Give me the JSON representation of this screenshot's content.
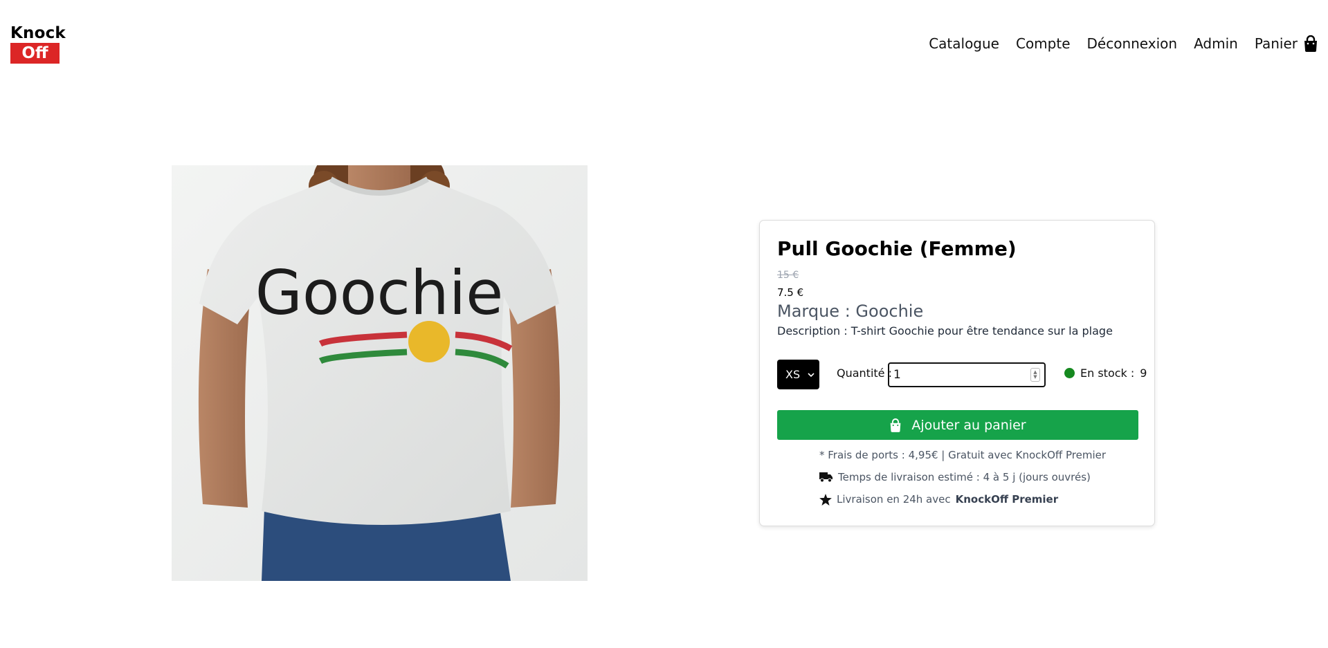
{
  "header": {
    "logo_top": "Knock",
    "logo_bottom": "Off",
    "nav": {
      "catalogue": "Catalogue",
      "compte": "Compte",
      "deconnexion": "Déconnexion",
      "admin": "Admin",
      "panier": "Panier"
    }
  },
  "product": {
    "image_text": "Goochie",
    "title": "Pull Goochie (Femme)",
    "old_price": "15 €",
    "price": "7.5 €",
    "brand": "Marque : Goochie",
    "description": "Description : T-shirt Goochie pour être tendance sur la plage",
    "size": {
      "selected": "XS"
    },
    "quantity": {
      "label": "Quantité :",
      "value": "1"
    },
    "stock": {
      "label": "En stock :",
      "count": "9",
      "color": "#15891f"
    },
    "add_to_cart": "Ajouter au panier",
    "shipping_note": "* Frais de ports : 4,95€ | Gratuit avec  KnockOff Premier",
    "delivery_note": "Temps de livraison estimé : 4 à 5 j (jours ouvrés)",
    "premium_note_prefix": "Livraison en 24h avec",
    "premium_note_brand": "KnockOff Premier"
  },
  "colors": {
    "brand_red": "#dc2626",
    "button_green": "#16a34a"
  },
  "icons": {
    "cart": "shopping-bag-icon",
    "truck": "truck-icon",
    "star": "star-icon",
    "chevron": "chevron-down-icon"
  }
}
